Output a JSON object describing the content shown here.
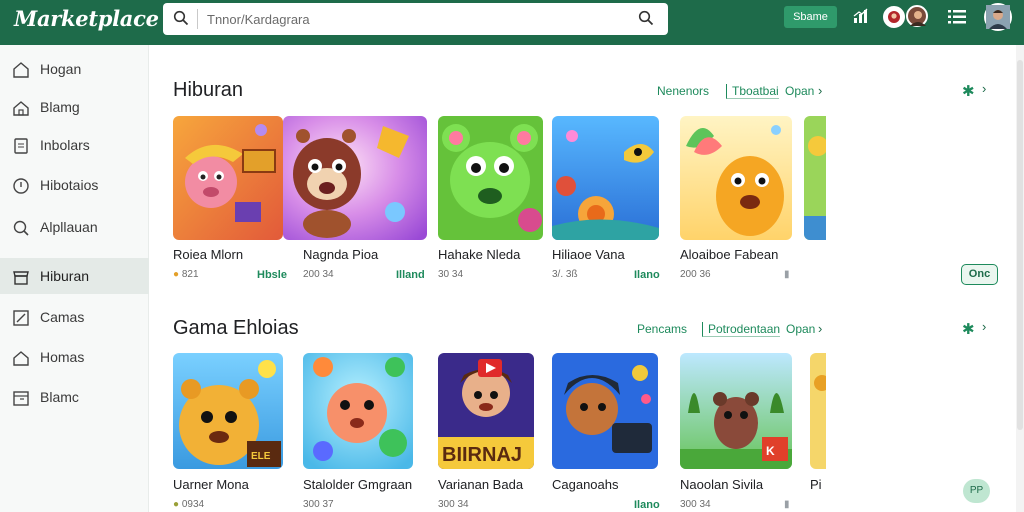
{
  "app": {
    "title": "Marketplace"
  },
  "search": {
    "placeholder": "Tnnor/Kardagrara"
  },
  "topbar": {
    "signin_label": "Sbame"
  },
  "sidebar": {
    "items": [
      {
        "label": "Hogan",
        "icon": "home-icon",
        "active": false
      },
      {
        "label": "Blamg",
        "icon": "home-outline-icon",
        "active": false
      },
      {
        "label": "Inbolars",
        "icon": "document-icon",
        "active": false
      },
      {
        "label": "Hibotaios",
        "icon": "clock-icon",
        "active": false
      },
      {
        "label": "Alpllauan",
        "icon": "search-icon",
        "active": false
      },
      {
        "label": "Hiburan",
        "icon": "store-icon",
        "active": true
      },
      {
        "label": "Camas",
        "icon": "edit-icon",
        "active": false
      },
      {
        "label": "Homas",
        "icon": "home-icon",
        "active": false
      },
      {
        "label": "Blamc",
        "icon": "calendar-icon",
        "active": false
      }
    ]
  },
  "sections": [
    {
      "title": "Hiburan",
      "links": [
        "Nenenors",
        "Tboatbai",
        "Opan"
      ],
      "cards": [
        {
          "title": "Roiea Mlorn",
          "meta": "821",
          "badge": "Hbsle"
        },
        {
          "title": "Nagnda Pioa",
          "meta": "200 34",
          "badge": "Illand"
        },
        {
          "title": "Hahake Nleda",
          "meta": "30 34",
          "badge": ""
        },
        {
          "title": "Hiliaoe Vana",
          "meta": "3/. 3ß",
          "badge": "Ilano"
        },
        {
          "title": "Aloaiboe Fabean",
          "meta": "200 36",
          "badge": ""
        }
      ]
    },
    {
      "title": "Gama Ehloias",
      "links": [
        "Pencams",
        "Potrodentaan",
        "Opan"
      ],
      "cards": [
        {
          "title": "Uarner Mona",
          "meta": "0934",
          "badge": ""
        },
        {
          "title": "Stalolder Gmgraan",
          "meta": "300 37",
          "badge": ""
        },
        {
          "title": "Varianan Bada",
          "meta": "300 34",
          "badge": ""
        },
        {
          "title": "Caganoahs",
          "meta": "",
          "badge": "Ilano"
        },
        {
          "title": "Naoolan Sivila",
          "meta": "300 34",
          "badge": ""
        }
      ]
    }
  ],
  "install_badge": "Onc",
  "fab_label": "PP",
  "partial_card_title": "Pi",
  "colors": {
    "brand": "#1e6b4a",
    "accent": "#2f9a6b"
  }
}
